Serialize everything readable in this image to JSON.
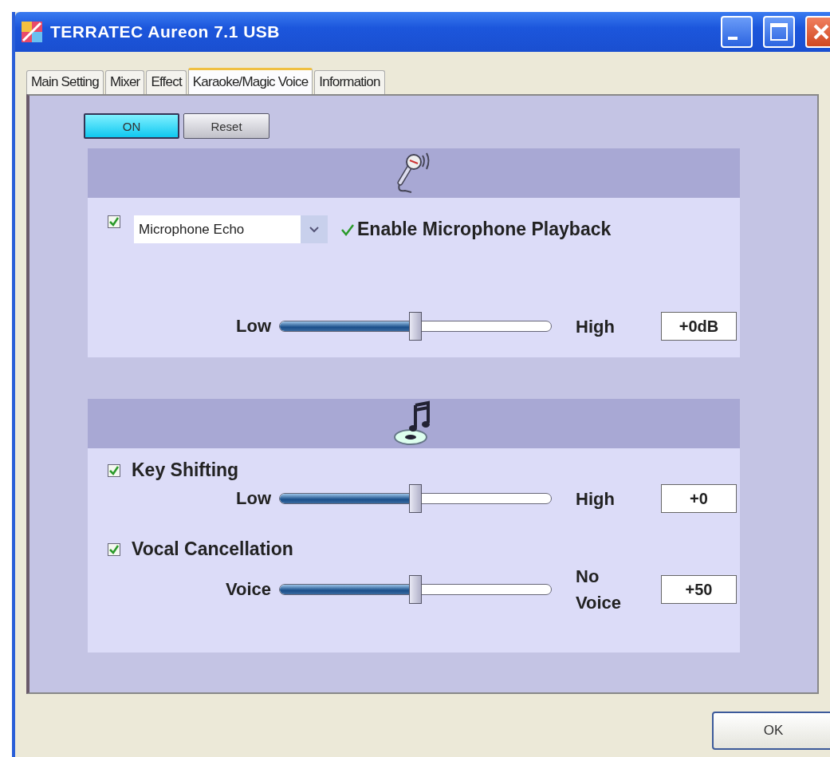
{
  "window": {
    "title": "TERRATEC Aureon 7.1 USB"
  },
  "tabs": [
    {
      "label": "Main Setting",
      "selected": false
    },
    {
      "label": "Mixer",
      "selected": false
    },
    {
      "label": "Effect",
      "selected": false
    },
    {
      "label": "Karaoke/Magic Voice",
      "selected": true
    },
    {
      "label": "Information",
      "selected": false
    }
  ],
  "power_button": {
    "label": "ON",
    "on": true
  },
  "reset_button": {
    "label": "Reset"
  },
  "microphone_panel": {
    "enabled": true,
    "effect": "Microphone Echo",
    "playback": {
      "label": "Enable Microphone Playback",
      "checked": true
    },
    "slider": {
      "min_label": "Low",
      "max_label": "High",
      "level": 0.5,
      "reading": "+0dB"
    }
  },
  "music_panel": {
    "controls": [
      {
        "label": "Key Shifting",
        "checked": true,
        "min_label": "Low",
        "max_label": "High",
        "level": 0.5,
        "reading": "+0"
      },
      {
        "label": "Vocal Cancellation",
        "checked": true,
        "min_label": "Voice",
        "max_label": "No Voice",
        "level": 0.5,
        "reading": "+50"
      }
    ]
  },
  "ok_button": {
    "label": "OK"
  }
}
